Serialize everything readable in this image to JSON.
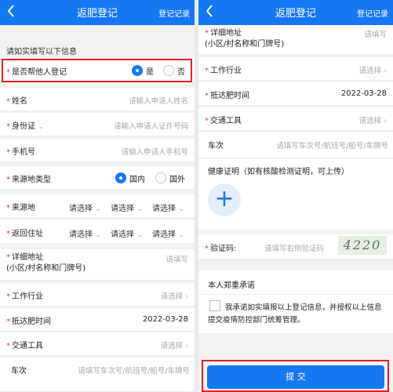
{
  "header": {
    "back_icon": "chevron-left-icon",
    "title": "返肥登记",
    "record_link": "登记记录"
  },
  "hint": "请如实填写以下信息",
  "left": {
    "help_register": {
      "label": "是否帮他人登记",
      "yes": "是",
      "no": "否",
      "selected": "是"
    },
    "name": {
      "label": "姓名",
      "placeholder": "请输入申请人姓名"
    },
    "id_type": {
      "label": "身份证",
      "placeholder": "请输入申请人证件号码"
    },
    "phone": {
      "label": "手机号",
      "placeholder": "请输入申请人手机号"
    },
    "origin_type": {
      "label": "来源地类型",
      "domestic": "国内",
      "abroad": "国外",
      "selected": "国内"
    },
    "origin": {
      "label": "来源地",
      "selects": [
        "请选择",
        "请选择",
        "请选择"
      ]
    },
    "return_residence": {
      "label": "返回住址",
      "selects": [
        "请选择",
        "请选择",
        "请选择"
      ]
    },
    "address": {
      "label_line1": "详细地址",
      "label_line2": "(小区/村名称和门牌号)",
      "placeholder": "请填写"
    },
    "industry": {
      "label": "工作行业",
      "placeholder": "请选择"
    },
    "arrival_time": {
      "label": "抵达肥时间",
      "value": "2022-03-28"
    },
    "transport": {
      "label": "交通工具",
      "placeholder": "请选择"
    },
    "train": {
      "label": "车次",
      "placeholder": "请填写车次号/航班号/船号/车牌号"
    }
  },
  "right": {
    "address": {
      "label_line1": "详细地址",
      "label_line2": "(小区/村名称和门牌号)",
      "placeholder": "请填写"
    },
    "industry": {
      "label": "工作行业",
      "placeholder": "请选择"
    },
    "arrival_time": {
      "label": "抵达肥时间",
      "value": "2022-03-28"
    },
    "transport": {
      "label": "交通工具",
      "placeholder": "请选择"
    },
    "train": {
      "label": "车次",
      "placeholder": "请填写车次号/航班号/船号/车牌号"
    },
    "health_cert": {
      "label": "健康证明（如有核酸检测证明，可上传）",
      "upload_icon": "plus-icon"
    },
    "captcha": {
      "label": "验证码:",
      "placeholder": "请填写右侧验证码",
      "image_text": "4220"
    },
    "promise": {
      "title": "本人郑重承诺",
      "text_line1": "我承诺如实填报以上登记信息，并授权以上信息",
      "text_line2": "提交疫情防控部门统筹管理。"
    },
    "submit": "提 交"
  },
  "colors": {
    "primary": "#1677f2",
    "required": "#e5393f",
    "highlight": "#e51e1e"
  }
}
